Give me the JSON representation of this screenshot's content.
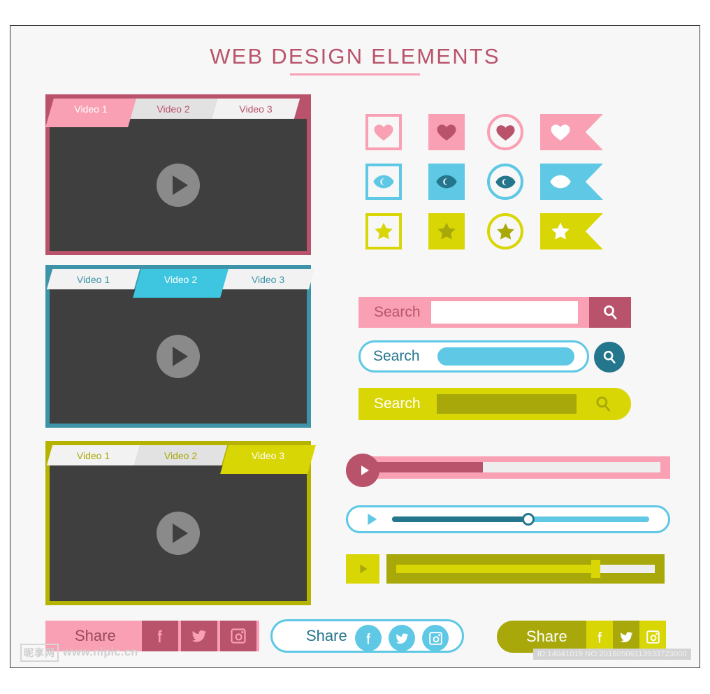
{
  "page": {
    "title": "WEB DESIGN ELEMENTS",
    "background": "#f7f7f7",
    "accent_pink": "#f9a0b4",
    "accent_pink_dark": "#b9536b",
    "accent_cyan": "#5ec8e5",
    "accent_cyan_dark": "#24768c",
    "accent_yellow": "#d9d606",
    "accent_yellow_dark": "#a8a80a",
    "screen_color": "#3f3f3f"
  },
  "players": [
    {
      "theme": "pink",
      "frame_color": "#b9536b",
      "active_color": "#f9a0b4",
      "inactive_color_1": "#f2f2f2",
      "inactive_color_2": "#e2e2e2",
      "label_color": "#b9536b",
      "tabs": [
        {
          "label": "Video 1",
          "active": true
        },
        {
          "label": "Video 2",
          "active": false
        },
        {
          "label": "Video 3",
          "active": false
        }
      ],
      "play_button": "play-icon"
    },
    {
      "theme": "cyan",
      "frame_color": "#3d93a8",
      "active_color": "#3ec6e0",
      "inactive_color_1": "#f2f2f2",
      "inactive_color_2": "#e2e2e2",
      "label_color": "#3d93a8",
      "tabs": [
        {
          "label": "Video 1",
          "active": false
        },
        {
          "label": "Video 2",
          "active": true
        },
        {
          "label": "Video 3",
          "active": false
        }
      ],
      "play_button": "play-icon"
    },
    {
      "theme": "yellow",
      "frame_color": "#b5b300",
      "active_color": "#d9d606",
      "inactive_color_1": "#f2f2f2",
      "inactive_color_2": "#e2e2e2",
      "label_color": "#a8a80a",
      "tabs": [
        {
          "label": "Video 1",
          "active": false
        },
        {
          "label": "Video 2",
          "active": false
        },
        {
          "label": "Video 3",
          "active": true
        }
      ],
      "play_button": "play-icon"
    }
  ],
  "icon_grid": {
    "rows": [
      {
        "icon": "heart-icon",
        "frame_color": "#f9a0b4",
        "glyph_color_on_light": "#f9a0b4",
        "glyph_color_on_fill": "#b9536b",
        "glyph_color_on_ribbon": "#ffffff",
        "variants": [
          "outlined-square",
          "filled-square",
          "outlined-circle",
          "ribbon"
        ]
      },
      {
        "icon": "eye-icon",
        "frame_color": "#5ec8e5",
        "glyph_color_on_light": "#5ec8e5",
        "glyph_color_on_fill": "#24768c",
        "glyph_color_on_ribbon": "#ffffff",
        "variants": [
          "outlined-square",
          "filled-square",
          "outlined-circle",
          "ribbon"
        ]
      },
      {
        "icon": "star-icon",
        "frame_color": "#d9d606",
        "glyph_color_on_light": "#d9d606",
        "glyph_color_on_fill": "#a8a80a",
        "glyph_color_on_ribbon": "#ffffff",
        "variants": [
          "outlined-square",
          "filled-square",
          "outlined-circle",
          "ribbon"
        ]
      }
    ]
  },
  "search_bars": [
    {
      "theme": "pink",
      "label": "Search",
      "placeholder": "",
      "value": "",
      "bar_color": "#f9a0b4",
      "field_color": "#ffffff",
      "button_color": "#b9536b",
      "label_color": "#b9536b",
      "icon_color": "#ffffff",
      "icon": "search-icon",
      "shape": "square"
    },
    {
      "theme": "cyan",
      "label": "Search",
      "placeholder": "",
      "value": "",
      "bar_color": "#ffffff",
      "border_color": "#5ec8e5",
      "field_color": "#5ec8e5",
      "button_color": "#24768c",
      "label_color": "#24768c",
      "icon_color": "#ffffff",
      "icon": "search-icon",
      "shape": "pill-outline"
    },
    {
      "theme": "yellow",
      "label": "Search",
      "placeholder": "",
      "value": "",
      "bar_color": "#d9d606",
      "field_color": "#a8a80a",
      "button_color": "transparent",
      "label_color": "#ffffff",
      "icon_color": "#a8a80a",
      "icon": "search-icon",
      "shape": "half-pill"
    }
  ],
  "progress_bars": [
    {
      "theme": "pink",
      "play_icon": "play-icon",
      "play_bg": "#b9536b",
      "play_glyph": "#ffffff",
      "track_bg": "#f9a0b4",
      "track_empty": "#eeeeee",
      "track_fill": "#b9536b",
      "progress_percent": 38,
      "handle": "none"
    },
    {
      "theme": "cyan",
      "play_icon": "play-icon",
      "play_bg": "transparent",
      "play_glyph": "#5ec8e5",
      "track_bg": "#ffffff",
      "border_color": "#5ec8e5",
      "track_empty": "#5ec8e5",
      "track_fill": "#24768c",
      "progress_percent": 53,
      "handle": "circle-knob",
      "handle_color": "#ffffff"
    },
    {
      "theme": "yellow",
      "play_icon": "play-icon",
      "play_bg": "#d9d606",
      "play_glyph": "#a8a80a",
      "track_bg": "#a8a80a",
      "track_empty": "#eeeeee",
      "track_fill": "#d9d606",
      "progress_percent": 77,
      "handle": "square-knob",
      "handle_color": "#d9d606"
    }
  ],
  "share_bars": [
    {
      "theme": "pink",
      "label": "Share",
      "bar_color": "#f9a0b4",
      "label_color": "#9b4a5e",
      "button_color": "#b9536b",
      "icon_color": "#f9a0b4",
      "shape": "square",
      "icons": [
        "facebook-icon",
        "twitter-icon",
        "instagram-icon"
      ]
    },
    {
      "theme": "cyan",
      "label": "Share",
      "bar_color": "#ffffff",
      "border_color": "#5ec8e5",
      "label_color": "#24768c",
      "button_color": "#5ec8e5",
      "icon_color": "#ffffff",
      "shape": "pill-outline",
      "icons": [
        "facebook-icon",
        "twitter-icon",
        "instagram-icon"
      ]
    },
    {
      "theme": "yellow",
      "label": "Share",
      "bar_color": "#a8a80a",
      "label_color": "#ffffff",
      "button_color": "#d9d606",
      "button_color_alt": "#a8a80a",
      "icon_color": "#ffffff",
      "shape": "half-pill",
      "icons": [
        "facebook-icon",
        "twitter-icon",
        "instagram-icon"
      ]
    }
  ],
  "footer": {
    "watermark_logo": "昵享网",
    "watermark_url": "www.nipic.cn",
    "id_badge": "ID:14041019 NO:20160506113933723000"
  }
}
